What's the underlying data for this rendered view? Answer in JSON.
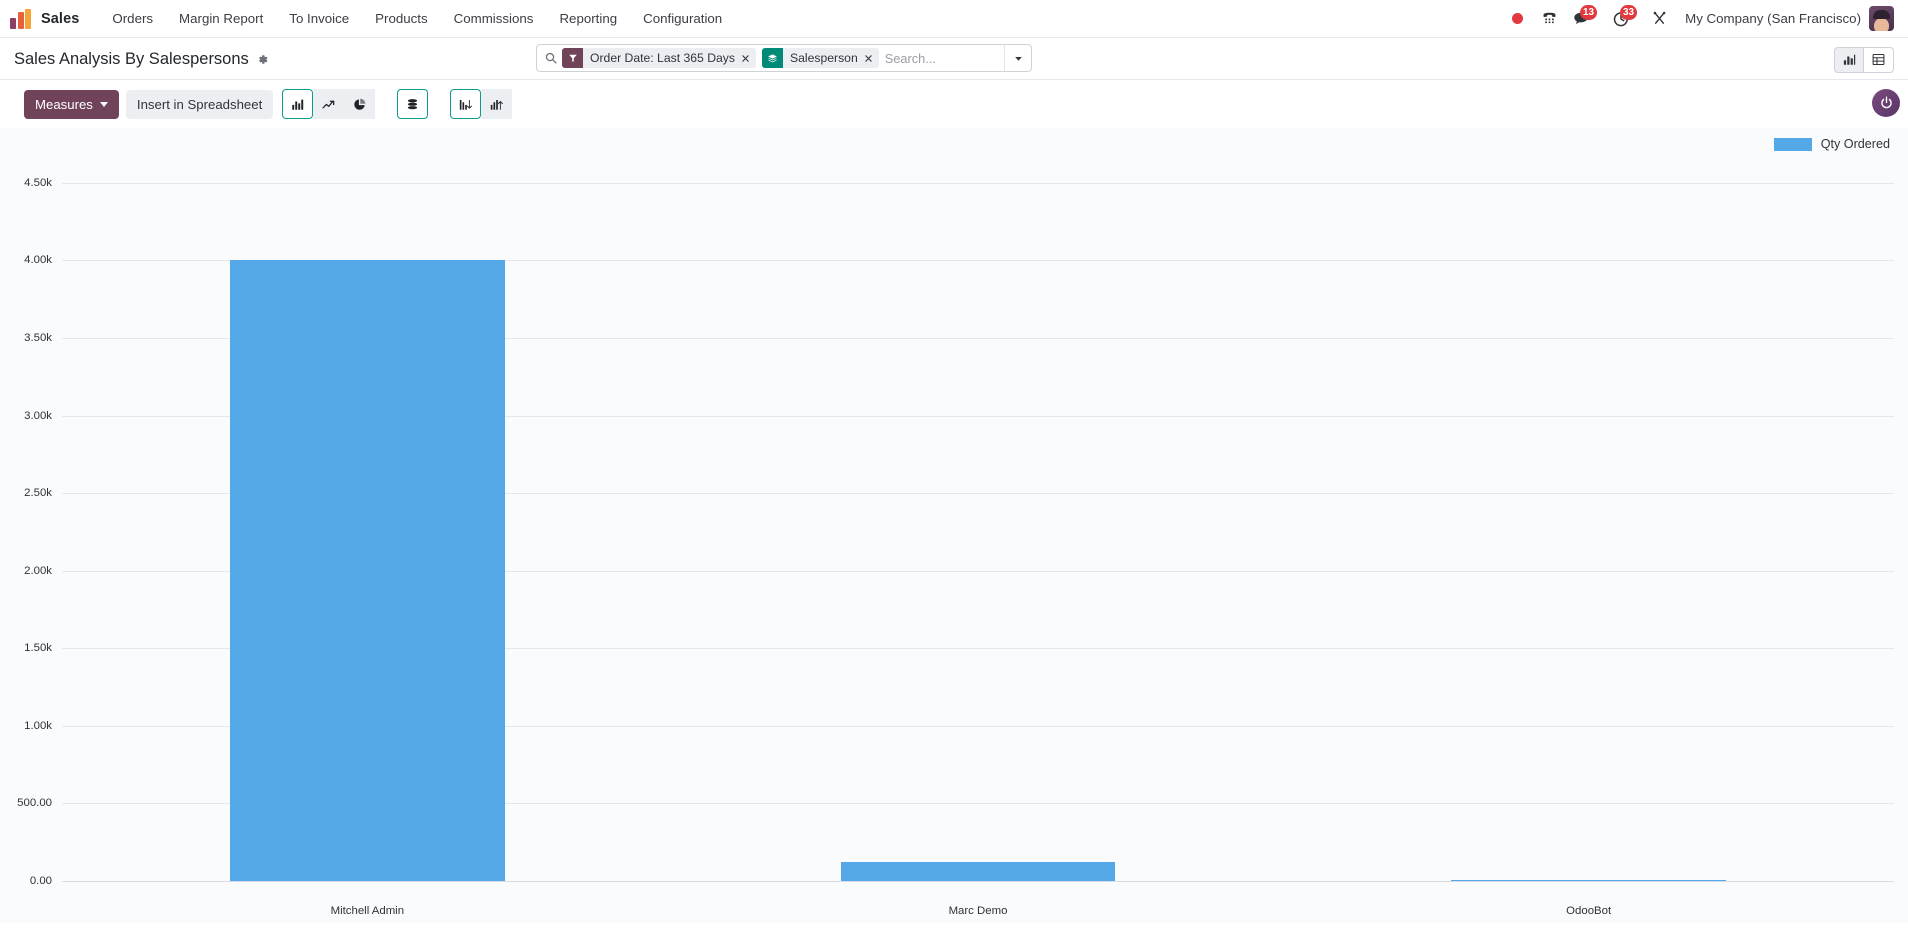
{
  "navbar": {
    "app_name": "Sales",
    "logo_icon": "odoo-logo-icon",
    "menu": [
      {
        "label": "Orders"
      },
      {
        "label": "Margin Report"
      },
      {
        "label": "To Invoice"
      },
      {
        "label": "Products"
      },
      {
        "label": "Commissions"
      },
      {
        "label": "Reporting"
      },
      {
        "label": "Configuration"
      }
    ],
    "systray": {
      "recording_icon": "record-dot-icon",
      "dialpad_icon": "dialpad-phone-icon",
      "messages_icon": "chat-bubble-icon",
      "messages_count": "13",
      "activities_icon": "clock-activity-icon",
      "activities_count": "33",
      "shortcut_icon": "scissors-icon"
    },
    "company": "My Company (San Francisco)",
    "avatar_icon": "user-avatar"
  },
  "control_panel": {
    "title": "Sales Analysis By Salespersons",
    "settings_icon": "gear-icon",
    "search": {
      "search_icon": "magnifier-icon",
      "placeholder": "Search...",
      "value": "",
      "dropdown_icon": "caret-down-icon",
      "facets": [
        {
          "icon": "filter-funnel-icon",
          "label": "Order Date: Last 365 Days",
          "color": "#71435b",
          "remove_icon": "close-x-icon"
        },
        {
          "icon": "group-layers-icon",
          "label": "Salesperson",
          "color": "#028a78",
          "remove_icon": "close-x-icon"
        }
      ]
    },
    "view_switcher": [
      {
        "icon": "graph-view-icon",
        "active": true
      },
      {
        "icon": "pivot-view-icon",
        "active": false
      }
    ]
  },
  "toolbar": {
    "measures_label": "Measures",
    "measures_caret_icon": "caret-down-icon",
    "spreadsheet_label": "Insert in Spreadsheet",
    "chart_type_buttons": [
      {
        "icon": "bar-chart-icon",
        "active": true
      },
      {
        "icon": "line-chart-icon",
        "active": false
      },
      {
        "icon": "pie-chart-icon",
        "active": false
      }
    ],
    "stack_buttons": [
      {
        "icon": "stacked-bars-icon",
        "active": true
      }
    ],
    "sort_buttons": [
      {
        "icon": "sort-descending-icon",
        "active": true
      },
      {
        "icon": "sort-ascending-icon",
        "active": false
      }
    ],
    "assistant_icon": "odoo-assistant-icon",
    "assistant_glyph": "◉"
  },
  "chart_data": {
    "type": "bar",
    "title": "",
    "xlabel": "",
    "ylabel": "",
    "categories": [
      "Mitchell Admin",
      "Marc Demo",
      "OdooBot"
    ],
    "values": [
      4000,
      125,
      8
    ],
    "series": [
      {
        "name": "Qty Ordered",
        "color": "#54a8e8",
        "values": [
          4000,
          125,
          8
        ]
      }
    ],
    "legend": [
      {
        "label": "Qty Ordered",
        "color": "#54a8e8"
      }
    ],
    "legend_position": "top-right",
    "grid": true,
    "ylim": [
      0,
      4750
    ],
    "yticks": [
      0,
      500,
      1000,
      1500,
      2000,
      2500,
      3000,
      3500,
      4000,
      4500
    ],
    "ytick_labels": [
      "0.00",
      "500.00",
      "1.00k",
      "1.50k",
      "2.00k",
      "2.50k",
      "3.00k",
      "3.50k",
      "4.00k",
      "4.50k"
    ]
  }
}
